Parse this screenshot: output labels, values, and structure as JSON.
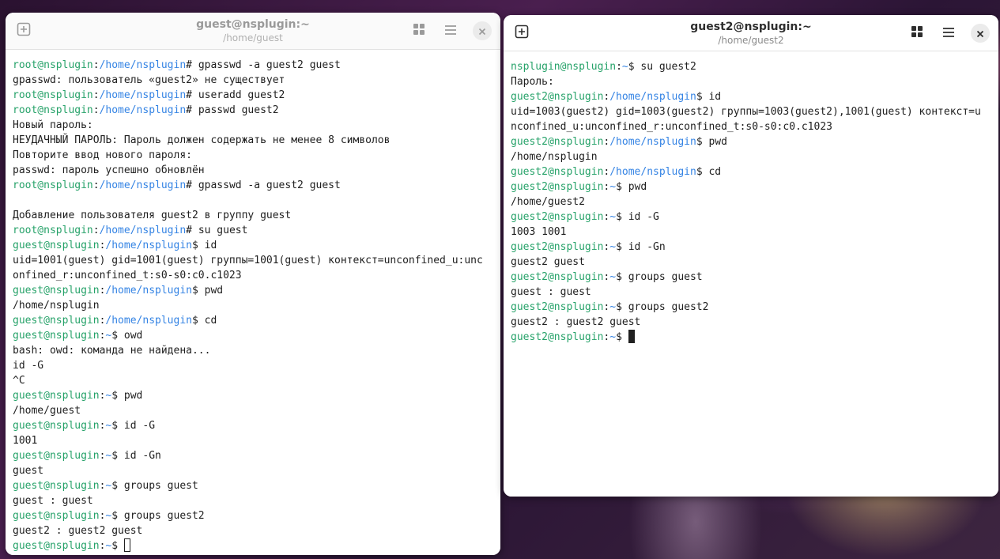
{
  "left_window": {
    "title": "guest@nsplugin:~",
    "subtitle": "/home/guest",
    "lines": [
      {
        "u": "root@nsplugin",
        "p": "/home/nsplugin",
        "s": "# ",
        "c": "gpasswd -a guest2 guest"
      },
      {
        "t": "gpasswd: пользователь «guest2» не существует"
      },
      {
        "u": "root@nsplugin",
        "p": "/home/nsplugin",
        "s": "# ",
        "c": "useradd guest2"
      },
      {
        "u": "root@nsplugin",
        "p": "/home/nsplugin",
        "s": "# ",
        "c": "passwd guest2"
      },
      {
        "t": "Новый пароль:"
      },
      {
        "t": "НЕУДАЧНЫЙ ПАРОЛЬ: Пароль должен содержать не менее 8 символов"
      },
      {
        "t": "Повторите ввод нового пароля:"
      },
      {
        "t": "passwd: пароль успешно обновлён"
      },
      {
        "u": "root@nsplugin",
        "p": "/home/nsplugin",
        "s": "# ",
        "c": "gpasswd -a guest2 guest"
      },
      {
        "t": ""
      },
      {
        "t": "Добавление пользователя guest2 в группу guest"
      },
      {
        "u": "root@nsplugin",
        "p": "/home/nsplugin",
        "s": "# ",
        "c": "su guest"
      },
      {
        "u": "guest@nsplugin",
        "p": "/home/nsplugin",
        "s": "$ ",
        "c": "id"
      },
      {
        "t": "uid=1001(guest) gid=1001(guest) группы=1001(guest) контекст=unconfined_u:unc"
      },
      {
        "t": "onfined_r:unconfined_t:s0-s0:c0.c1023"
      },
      {
        "u": "guest@nsplugin",
        "p": "/home/nsplugin",
        "s": "$ ",
        "c": "pwd"
      },
      {
        "t": "/home/nsplugin"
      },
      {
        "u": "guest@nsplugin",
        "p": "/home/nsplugin",
        "s": "$ ",
        "c": "cd"
      },
      {
        "u": "guest@nsplugin",
        "p": "~",
        "s": "$ ",
        "c": "owd"
      },
      {
        "t": "bash: owd: команда не найдена..."
      },
      {
        "t": "id -G"
      },
      {
        "t": "^C"
      },
      {
        "u": "guest@nsplugin",
        "p": "~",
        "s": "$ ",
        "c": "pwd"
      },
      {
        "t": "/home/guest"
      },
      {
        "u": "guest@nsplugin",
        "p": "~",
        "s": "$ ",
        "c": "id -G"
      },
      {
        "t": "1001"
      },
      {
        "u": "guest@nsplugin",
        "p": "~",
        "s": "$ ",
        "c": "id -Gn"
      },
      {
        "t": "guest"
      },
      {
        "u": "guest@nsplugin",
        "p": "~",
        "s": "$ ",
        "c": "groups guest"
      },
      {
        "t": "guest : guest"
      },
      {
        "u": "guest@nsplugin",
        "p": "~",
        "s": "$ ",
        "c": "groups guest2"
      },
      {
        "t": "guest2 : guest2 guest"
      },
      {
        "u": "guest@nsplugin",
        "p": "~",
        "s": "$ ",
        "c": "",
        "cursor": "hollow"
      }
    ]
  },
  "right_window": {
    "title": "guest2@nsplugin:~",
    "subtitle": "/home/guest2",
    "lines": [
      {
        "u": "nsplugin@nsplugin",
        "p": "~",
        "s": "$ ",
        "c": "su guest2"
      },
      {
        "t": "Пароль:"
      },
      {
        "u": "guest2@nsplugin",
        "p": "/home/nsplugin",
        "s": "$ ",
        "c": "id"
      },
      {
        "t": "uid=1003(guest2) gid=1003(guest2) группы=1003(guest2),1001(guest) контекст=u"
      },
      {
        "t": "nconfined_u:unconfined_r:unconfined_t:s0-s0:c0.c1023"
      },
      {
        "u": "guest2@nsplugin",
        "p": "/home/nsplugin",
        "s": "$ ",
        "c": "pwd"
      },
      {
        "t": "/home/nsplugin"
      },
      {
        "u": "guest2@nsplugin",
        "p": "/home/nsplugin",
        "s": "$ ",
        "c": "cd"
      },
      {
        "u": "guest2@nsplugin",
        "p": "~",
        "s": "$ ",
        "c": "pwd"
      },
      {
        "t": "/home/guest2"
      },
      {
        "u": "guest2@nsplugin",
        "p": "~",
        "s": "$ ",
        "c": "id -G"
      },
      {
        "t": "1003 1001"
      },
      {
        "u": "guest2@nsplugin",
        "p": "~",
        "s": "$ ",
        "c": "id -Gn"
      },
      {
        "t": "guest2 guest"
      },
      {
        "u": "guest2@nsplugin",
        "p": "~",
        "s": "$ ",
        "c": "groups guest"
      },
      {
        "t": "guest : guest"
      },
      {
        "u": "guest2@nsplugin",
        "p": "~",
        "s": "$ ",
        "c": "groups guest2"
      },
      {
        "t": "guest2 : guest2 guest"
      },
      {
        "u": "guest2@nsplugin",
        "p": "~",
        "s": "$ ",
        "c": "",
        "cursor": "solid"
      }
    ]
  },
  "icons": {
    "new_tab": "new-tab-icon",
    "tab_overview": "tab-overview-icon",
    "menu": "hamburger-menu-icon",
    "close": "close-icon"
  },
  "colors": {
    "prompt_user": "#26a269",
    "prompt_path": "#3584e4",
    "text": "#202020"
  }
}
